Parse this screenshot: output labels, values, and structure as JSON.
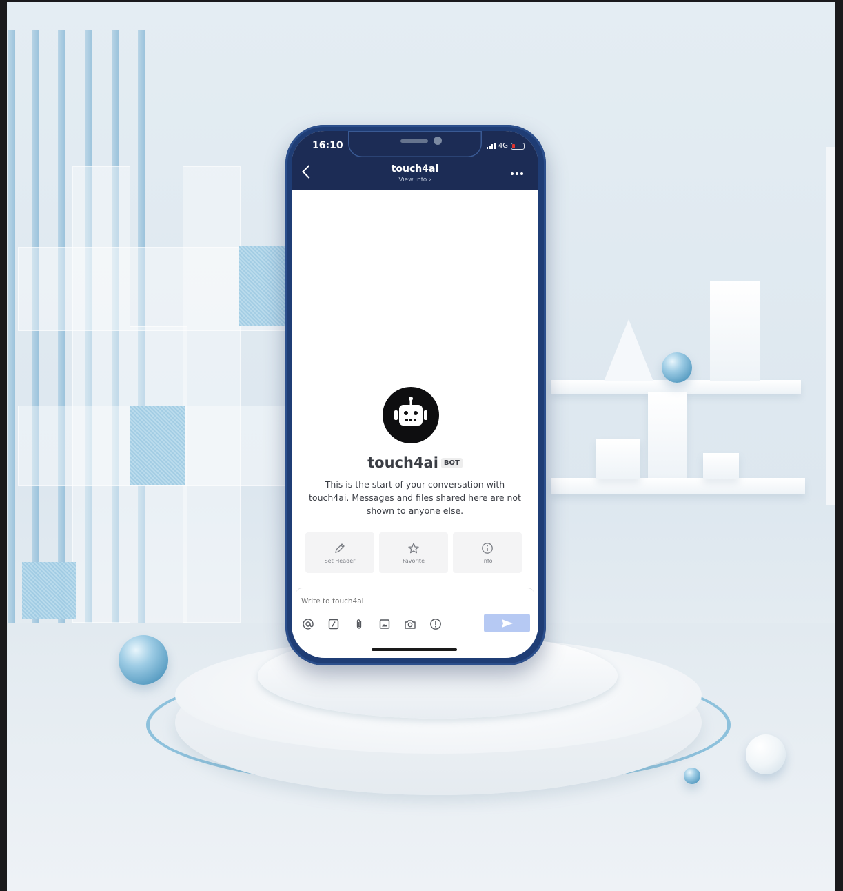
{
  "status_bar": {
    "time": "16:10",
    "network": "4G"
  },
  "header": {
    "title": "touch4ai",
    "subtitle": "View info ›"
  },
  "profile": {
    "name": "touch4ai",
    "badge": "BOT",
    "intro": "This is the start of your conversation with touch4ai. Messages and files shared here are not shown to anyone else."
  },
  "actions": [
    {
      "label": "Set Header",
      "icon": "pencil-icon"
    },
    {
      "label": "Favorite",
      "icon": "star-icon"
    },
    {
      "label": "Info",
      "icon": "info-icon"
    }
  ],
  "composer": {
    "placeholder": "Write to touch4ai",
    "tools": [
      "at-mention-icon",
      "slash-command-icon",
      "attachment-icon",
      "image-icon",
      "camera-icon",
      "priority-icon"
    ]
  },
  "colors": {
    "header_bg": "#1c2c55",
    "phone_frame": "#1f3d75",
    "send_button": "#b6c9f3",
    "battery_low": "#e0342f"
  }
}
